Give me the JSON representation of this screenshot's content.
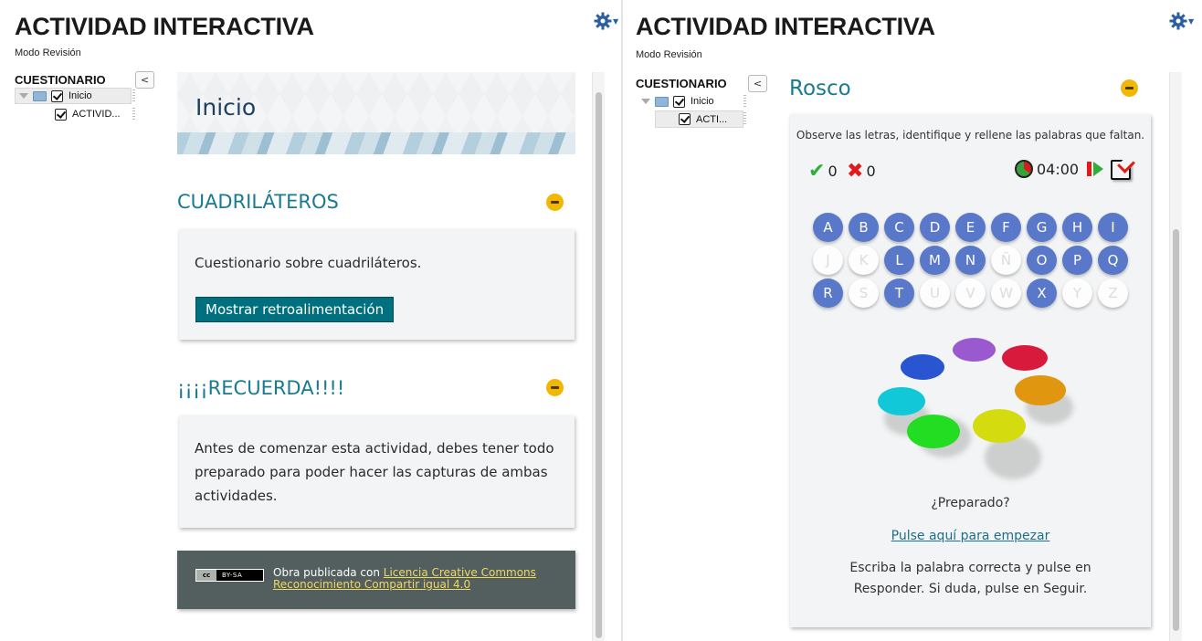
{
  "left": {
    "app_title": "ACTIVIDAD INTERACTIVA",
    "mode": "Modo Revisión",
    "toc": {
      "title": "CUESTIONARIO",
      "toggle": "<",
      "items": [
        {
          "label": "Inicio"
        },
        {
          "label": "ACTIVID..."
        }
      ]
    },
    "hero_title": "Inicio",
    "sections": [
      {
        "title": "CUADRILÁTEROS",
        "text": "Cuestionario sobre cuadriláteros.",
        "button": "Mostrar retroalimentación"
      },
      {
        "title": "¡¡¡¡RECUERDA!!!!",
        "text": "Antes de comenzar esta actividad, debes tener todo preparado para poder hacer las capturas de ambas actividades."
      }
    ],
    "license": {
      "badge_left": "cc",
      "badge_right": "BY-SA",
      "prefix": "Obra publicada con ",
      "link": "Licencia Creative Commons Reconocimiento Compartir igual 4.0"
    }
  },
  "right": {
    "app_title": "ACTIVIDAD INTERACTIVA",
    "mode": "Modo Revisión",
    "toc": {
      "title": "CUESTIONARIO",
      "toggle": "<",
      "items": [
        {
          "label": "Inicio"
        },
        {
          "label": "ACTI..."
        }
      ]
    },
    "activity_title": "Rosco",
    "instructions": "Observe las letras, identifique y rellene las palabras que faltan.",
    "hits": "0",
    "errors": "0",
    "timer": "04:00",
    "letters": [
      {
        "char": "A",
        "active": true
      },
      {
        "char": "B",
        "active": true
      },
      {
        "char": "C",
        "active": true
      },
      {
        "char": "D",
        "active": true
      },
      {
        "char": "E",
        "active": true
      },
      {
        "char": "F",
        "active": true
      },
      {
        "char": "G",
        "active": true
      },
      {
        "char": "H",
        "active": true
      },
      {
        "char": "I",
        "active": true
      },
      {
        "char": "J",
        "active": false
      },
      {
        "char": "K",
        "active": false
      },
      {
        "char": "L",
        "active": true
      },
      {
        "char": "M",
        "active": true
      },
      {
        "char": "N",
        "active": true
      },
      {
        "char": "Ñ",
        "active": false
      },
      {
        "char": "O",
        "active": true
      },
      {
        "char": "P",
        "active": true
      },
      {
        "char": "Q",
        "active": true
      },
      {
        "char": "R",
        "active": true
      },
      {
        "char": "S",
        "active": false
      },
      {
        "char": "T",
        "active": true
      },
      {
        "char": "U",
        "active": false
      },
      {
        "char": "V",
        "active": false
      },
      {
        "char": "W",
        "active": false
      },
      {
        "char": "X",
        "active": true
      },
      {
        "char": "Y",
        "active": false
      },
      {
        "char": "Z",
        "active": false
      }
    ],
    "disc_colors": [
      "#9b59d0",
      "#d81b3c",
      "#e0960e",
      "#d4dc10",
      "#22dd22",
      "#10c8d8",
      "#2a55d0"
    ],
    "ready": "¿Preparado?",
    "start_link": "Pulse aquí para empezar",
    "help": "Escriba la palabra correcta y pulse en Responder. Si duda, pulse en Seguir."
  },
  "colors": {
    "accent_teal": "#1a7a8f",
    "letter_blue": "#5a78c9",
    "collapse_yellow": "#f2b705",
    "license_bg": "#535f5e"
  }
}
